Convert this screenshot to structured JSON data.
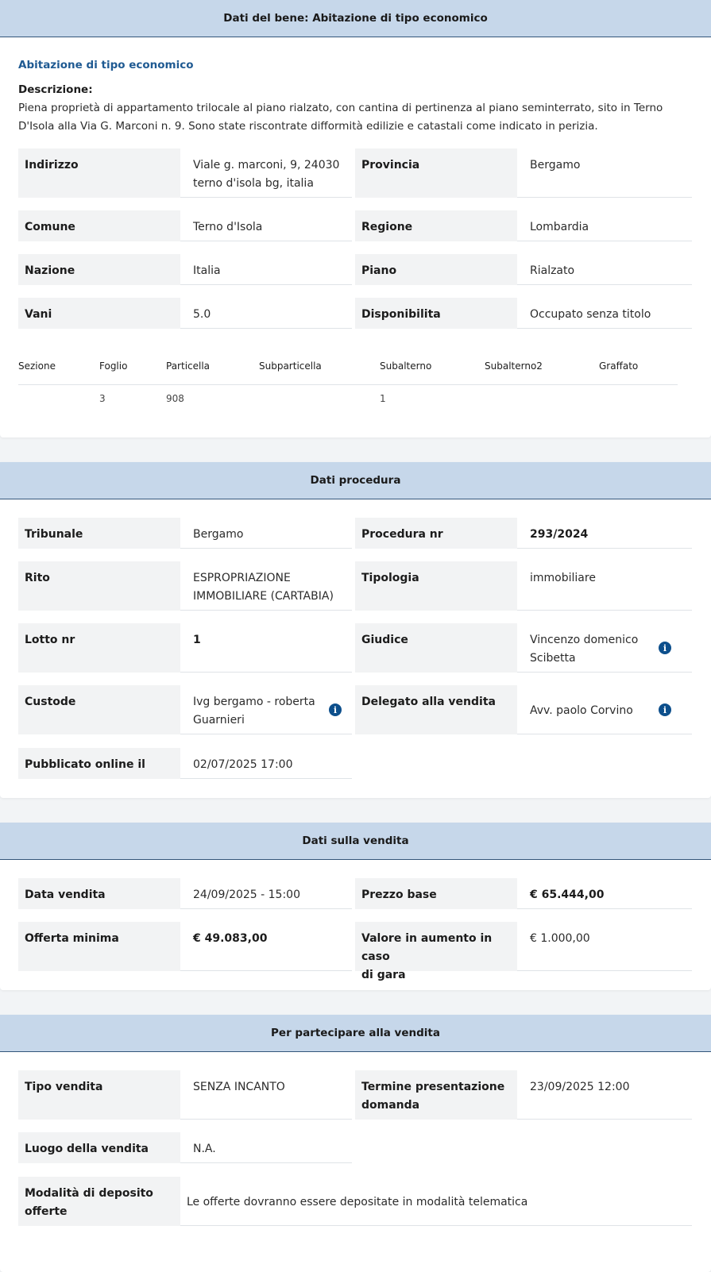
{
  "bene": {
    "header": "Dati del bene: Abitazione di tipo economico",
    "subtitle": "Abitazione di tipo economico",
    "desc_label": "Descrizione:",
    "desc_text": "Piena proprietà di appartamento trilocale al piano rialzato, con cantina di pertinenza al piano seminterrato, sito in Terno D'Isola alla Via G. Marconi n. 9. Sono state riscontrate difformità edilizie e catastali come indicato in perizia.",
    "indirizzo_label": "Indirizzo",
    "indirizzo_line1": "Viale g. marconi, 9, 24030",
    "indirizzo_line2": "terno d'isola bg, italia",
    "provincia_label": "Provincia",
    "provincia_value": "Bergamo",
    "comune_label": "Comune",
    "comune_value": "Terno d'Isola",
    "regione_label": "Regione",
    "regione_value": "Lombardia",
    "nazione_label": "Nazione",
    "nazione_value": "Italia",
    "piano_label": "Piano",
    "piano_value": "Rialzato",
    "vani_label": "Vani",
    "vani_value": "5.0",
    "disponibilita_label": "Disponibilita",
    "disponibilita_value": "Occupato senza titolo",
    "catasto": {
      "headers": [
        "Sezione",
        "Foglio",
        "Particella",
        "Subparticella",
        "Subalterno",
        "Subalterno2",
        "Graffato"
      ],
      "values": [
        "",
        "3",
        "908",
        "",
        "1",
        "",
        ""
      ]
    }
  },
  "procedura": {
    "header": "Dati procedura",
    "tribunale_label": "Tribunale",
    "tribunale_value": "Bergamo",
    "procedura_label": "Procedura nr",
    "procedura_value": "293/2024",
    "rito_label": "Rito",
    "rito_line1": "ESPROPRIAZIONE",
    "rito_line2": "IMMOBILIARE (CARTABIA)",
    "tipologia_label": "Tipologia",
    "tipologia_value": "immobiliare",
    "lotto_label": "Lotto nr",
    "lotto_value": "1",
    "giudice_label": "Giudice",
    "giudice_line1": "Vincenzo domenico",
    "giudice_line2": "Scibetta",
    "custode_label": "Custode",
    "custode_line1": "Ivg bergamo - roberta",
    "custode_line2": "Guarnieri",
    "delegato_label": "Delegato alla vendita",
    "delegato_value": "Avv. paolo Corvino",
    "pubblicato_label": "Pubblicato online il",
    "pubblicato_value": "02/07/2025 17:00"
  },
  "vendita": {
    "header": "Dati sulla vendita",
    "data_label": "Data vendita",
    "data_value": "24/09/2025 - 15:00",
    "prezzo_label": "Prezzo base",
    "prezzo_value": "€ 65.444,00",
    "offerta_label": "Offerta minima",
    "offerta_value": "€ 49.083,00",
    "aumento_line1": "Valore in aumento in caso",
    "aumento_line2": "di gara",
    "aumento_value": "€ 1.000,00"
  },
  "partecipare": {
    "header": "Per partecipare alla vendita",
    "tipo_label": "Tipo vendita",
    "tipo_value": "SENZA INCANTO",
    "termine_line1": "Termine presentazione",
    "termine_line2": "domanda",
    "termine_value": "23/09/2025 12:00",
    "luogo_label": "Luogo della vendita",
    "luogo_value": "N.A.",
    "modalita_line1": "Modalità di deposito",
    "modalita_line2": "offerte",
    "modalita_value": "Le offerte dovranno essere depositate in modalità telematica"
  },
  "icons": {
    "info": "info-icon",
    "info_color": "#0d4f8c"
  },
  "colors": {
    "header_bg": "#c6d7ea",
    "header_border": "#33567a",
    "label_bg": "#f2f3f4",
    "link_blue": "#1f5a92"
  }
}
